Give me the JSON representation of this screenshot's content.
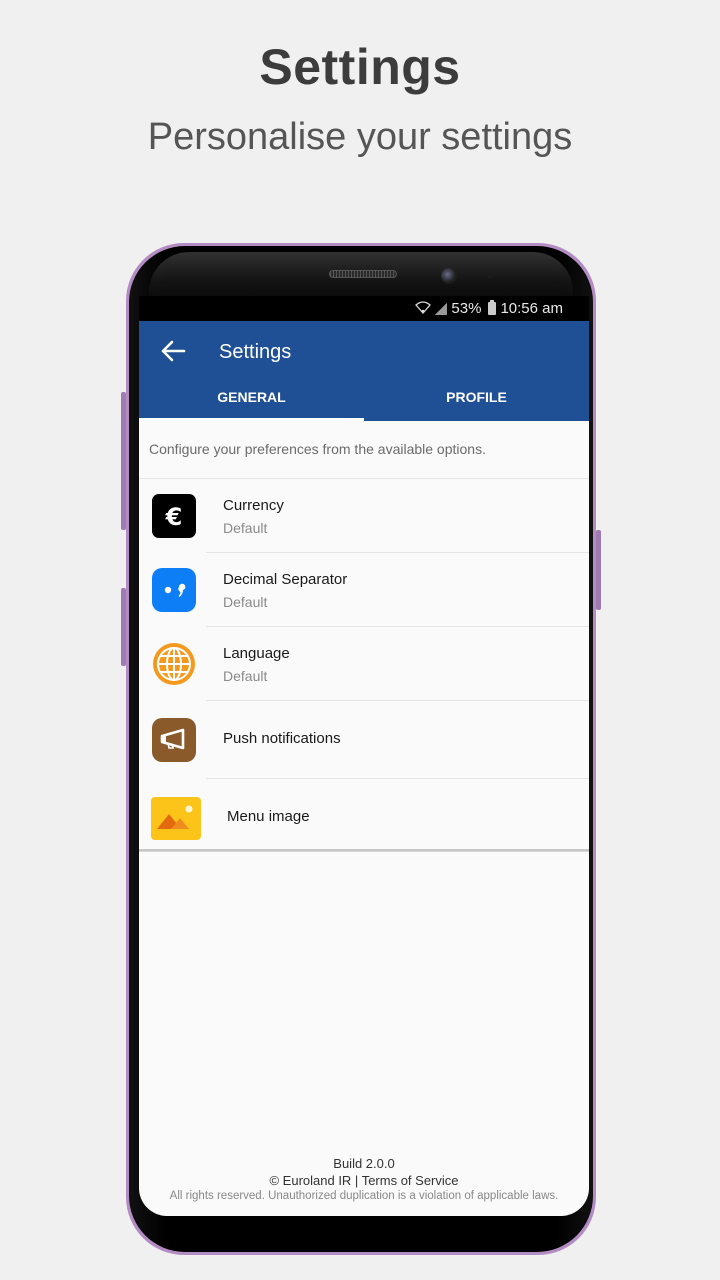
{
  "promo": {
    "title": "Settings",
    "subtitle": "Personalise your settings"
  },
  "status_bar": {
    "wifi_icon": "wifi-icon",
    "signal_icon": "cell-signal-icon",
    "battery_percent": "53%",
    "battery_icon": "battery-icon",
    "time": "10:56 am"
  },
  "app_bar": {
    "back_icon": "arrow-left-icon",
    "title": "Settings",
    "tabs": [
      {
        "label": "GENERAL",
        "active": true
      },
      {
        "label": "PROFILE",
        "active": false
      }
    ]
  },
  "description": "Configure your preferences from the available options.",
  "settings": [
    {
      "title": "Currency",
      "subtitle": "Default",
      "icon": "euro-icon",
      "icon_bg": "#000000"
    },
    {
      "title": "Decimal Separator",
      "subtitle": "Default",
      "icon": "decimal-separator-icon",
      "icon_bg": "#0d7ef5"
    },
    {
      "title": "Language",
      "subtitle": "Default",
      "icon": "globe-icon",
      "icon_bg": "#f39a1e"
    },
    {
      "title": "Push notifications",
      "icon": "megaphone-icon",
      "icon_bg": "#8b5a2b"
    },
    {
      "title": "Menu image",
      "icon": "image-icon",
      "icon_bg": "#fcc419"
    }
  ],
  "footer": {
    "build": "Build 2.0.0",
    "copyright": "© Euroland IR | Terms of Service",
    "rights": "All rights reserved. Unauthorized duplication is a violation of applicable laws."
  },
  "colors": {
    "primary": "#1f4f94",
    "background": "#f0f0f0",
    "phone_frame": "#b48cc4"
  }
}
